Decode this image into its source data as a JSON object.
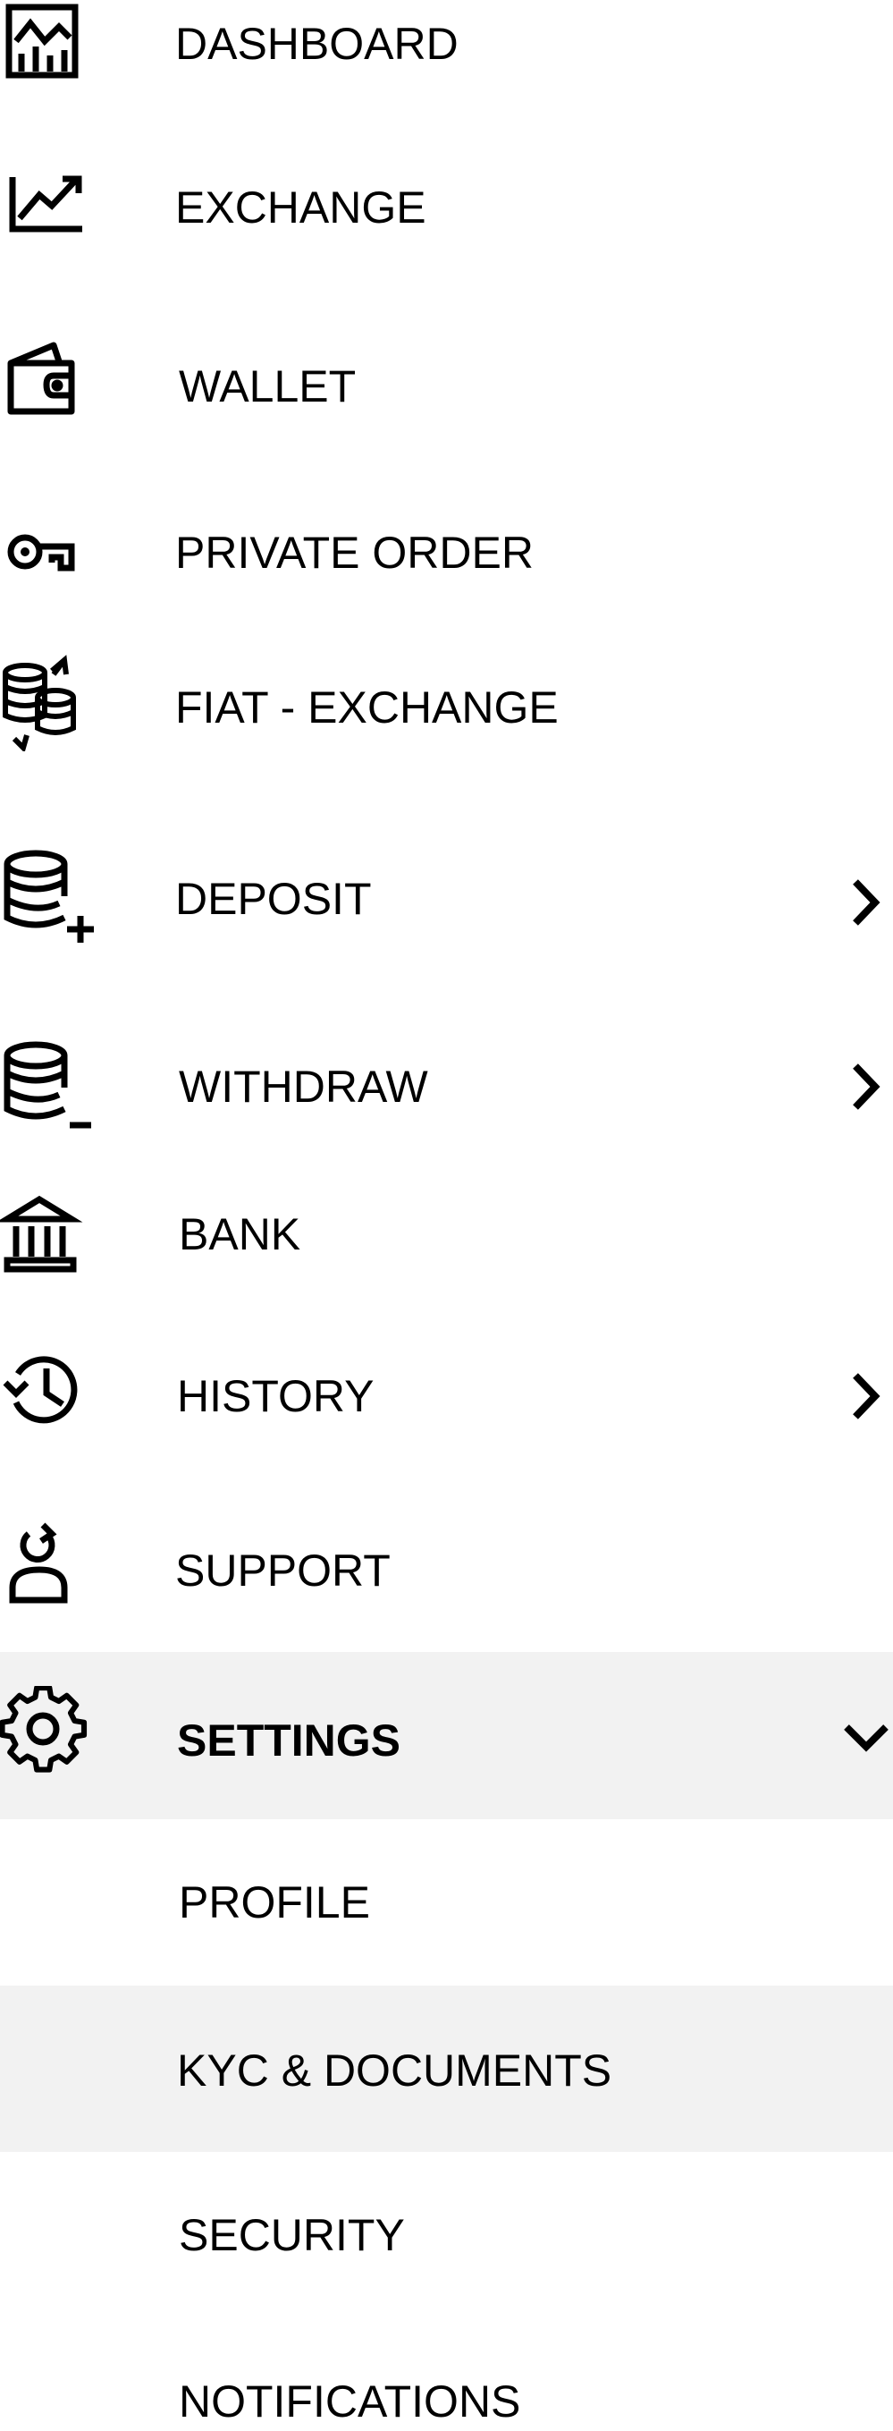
{
  "menu": {
    "items": [
      {
        "label": "DASHBOARD",
        "icon": "dashboard-chart-icon"
      },
      {
        "label": "EXCHANGE",
        "icon": "trend-line-icon"
      },
      {
        "label": "WALLET",
        "icon": "wallet-icon"
      },
      {
        "label": "PRIVATE ORDER",
        "icon": "key-icon"
      },
      {
        "label": "FIAT - EXCHANGE",
        "icon": "coins-exchange-icon"
      },
      {
        "label": "DEPOSIT",
        "icon": "database-plus-icon",
        "expandable": true
      },
      {
        "label": "WITHDRAW",
        "icon": "database-minus-icon",
        "expandable": true
      },
      {
        "label": "BANK",
        "icon": "bank-icon"
      },
      {
        "label": "HISTORY",
        "icon": "history-icon",
        "expandable": true
      },
      {
        "label": "SUPPORT",
        "icon": "support-user-icon"
      },
      {
        "label": "SETTINGS",
        "icon": "gear-icon",
        "expanded": true,
        "active": true
      }
    ],
    "settings_submenu": [
      {
        "label": "PROFILE"
      },
      {
        "label": "KYC & DOCUMENTS",
        "active": true
      },
      {
        "label": "SECURITY"
      },
      {
        "label": "NOTIFICATIONS"
      }
    ]
  },
  "colors": {
    "text": "#000000",
    "highlight_bg": "#f2f2f2",
    "background": "#ffffff"
  }
}
